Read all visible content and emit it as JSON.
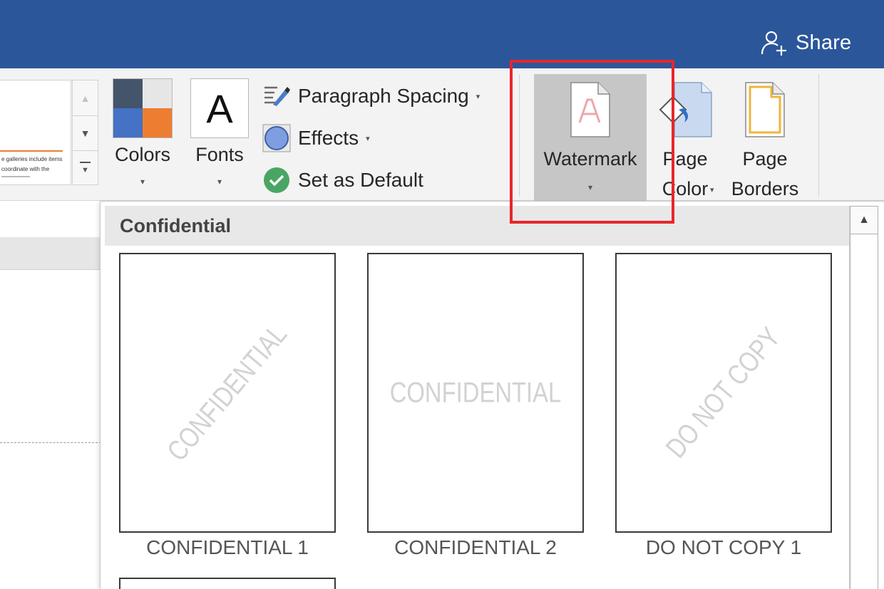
{
  "titlebar": {
    "share_label": "Share",
    "share_icon": "share-person-icon",
    "color": "#2b579a"
  },
  "theme_gallery": {
    "preview_line1": "e galleries include items",
    "preview_line2": "coordinate with the",
    "scroll_up_icon": "▲",
    "scroll_down_icon": "▼",
    "more_icon": "▼"
  },
  "ribbon": {
    "colors": {
      "label": "Colors",
      "caret": "▾",
      "swatches": [
        "#44546a",
        "#e7e6e6",
        "#4472c4",
        "#ed7d31"
      ]
    },
    "fonts": {
      "label": "Fonts",
      "glyph": "A",
      "caret": "▾"
    },
    "paragraph_spacing": {
      "label": "Paragraph Spacing",
      "caret": "▾"
    },
    "effects": {
      "label": "Effects",
      "caret": "▾"
    },
    "set_as_default": {
      "label": "Set as Default"
    },
    "watermark": {
      "label": "Watermark",
      "caret": "▾"
    },
    "page_color": {
      "line1": "Page",
      "line2": "Color",
      "caret": "▾"
    },
    "page_borders": {
      "line1": "Page",
      "line2": "Borders"
    },
    "highlight_color": "#e8262b"
  },
  "dropdown": {
    "section_title": "Confidential",
    "items": [
      {
        "watermark_text": "CONFIDENTIAL",
        "label": "CONFIDENTIAL 1"
      },
      {
        "watermark_text": "CONFIDENTIAL",
        "label": "CONFIDENTIAL 2"
      },
      {
        "watermark_text": "DO NOT COPY",
        "label": "DO NOT COPY 1"
      }
    ],
    "scroll_up_icon": "▲"
  }
}
